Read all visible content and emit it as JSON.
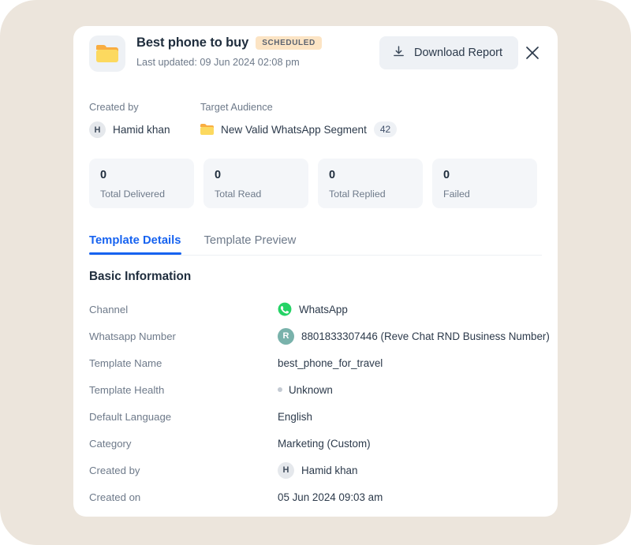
{
  "header": {
    "folder_icon": "folder-icon",
    "title": "Best phone to buy",
    "status_badge": "SCHEDULED",
    "subtitle": "Last updated: 09 Jun 2024 02:08 pm",
    "download_label": "Download Report",
    "download_icon": "download-icon",
    "close_icon": "close-icon"
  },
  "meta": {
    "created_by_label": "Created by",
    "created_by_initial": "H",
    "created_by_name": "Hamid khan",
    "target_audience_label": "Target Audience",
    "segment_icon": "folder-icon",
    "segment_name": "New Valid WhatsApp Segment",
    "segment_count": "42"
  },
  "stats": [
    {
      "value": "0",
      "label": "Total Delivered"
    },
    {
      "value": "0",
      "label": "Total Read"
    },
    {
      "value": "0",
      "label": "Total Replied"
    },
    {
      "value": "0",
      "label": "Failed"
    }
  ],
  "tabs": [
    {
      "label": "Template Details",
      "active": true
    },
    {
      "label": "Template Preview",
      "active": false
    }
  ],
  "basic_information": {
    "section_title": "Basic Information",
    "rows": [
      {
        "key": "Channel",
        "value": "WhatsApp",
        "icon": "whatsapp-icon"
      },
      {
        "key": "Whatsapp Number",
        "value": "8801833307446 (Reve Chat RND Business Number)",
        "avatar": "R"
      },
      {
        "key": "Template Name",
        "value": "best_phone_for_travel"
      },
      {
        "key": "Template Health",
        "value": "Unknown",
        "dot": true
      },
      {
        "key": "Default Language",
        "value": "English"
      },
      {
        "key": "Category",
        "value": "Marketing (Custom)"
      },
      {
        "key": "Created by",
        "value": "Hamid khan",
        "avatar": "H"
      },
      {
        "key": "Created on",
        "value": "05 Jun 2024 09:03 am"
      }
    ]
  },
  "colors": {
    "page_background": "#ece5dc",
    "card_background": "#ffffff",
    "accent_blue": "#1763f0",
    "badge_background": "#fce4c4",
    "stat_background": "#f4f6f9",
    "whatsapp_green": "#25d366",
    "folder_yellow": "#fcd95f"
  }
}
